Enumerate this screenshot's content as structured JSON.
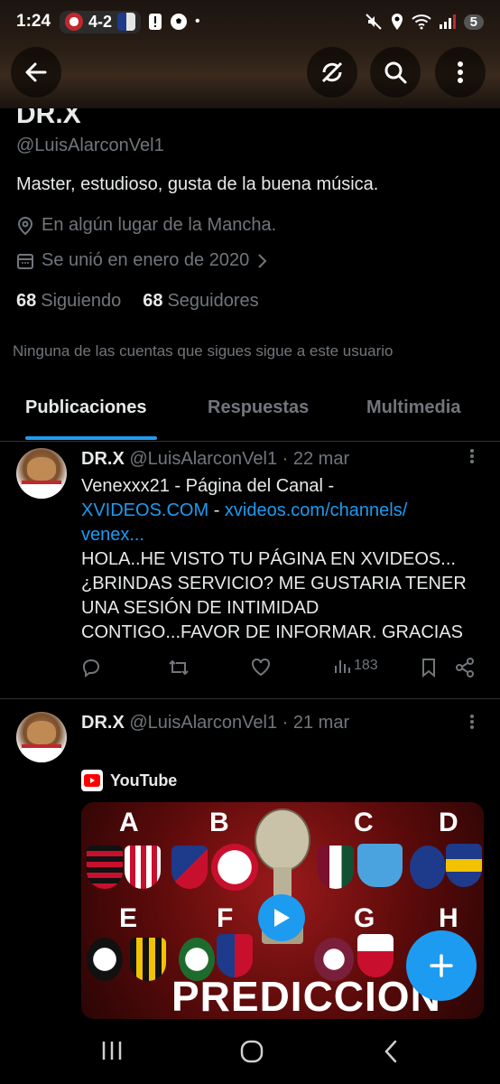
{
  "status_bar": {
    "time": "1:24",
    "score": "4-2",
    "battery": "5"
  },
  "profile": {
    "name": "DR.X",
    "handle": "@LuisAlarconVel1",
    "bio": "Master, estudioso, gusta de la buena música.",
    "location": "En algún lugar de la Mancha.",
    "joined": "Se unió en enero de 2020",
    "following_count": "68",
    "following_label": "Siguiendo",
    "followers_count": "68",
    "followers_label": "Seguidores",
    "mutual_notice": "Ninguna de las cuentas que sigues sigue a este usuario"
  },
  "tabs": [
    {
      "label": "Publicaciones",
      "active": true
    },
    {
      "label": "Respuestas",
      "active": false
    },
    {
      "label": "Multimedia",
      "active": false
    }
  ],
  "posts": [
    {
      "name": "DR.X",
      "handle": "@LuisAlarconVel1",
      "date": "· 22 mar",
      "line1": "Venexxx21 - Página del Canal -",
      "link1": "XVIDEOS.COM",
      "sep": " - ",
      "link2": "xvideos.com/channels/",
      "link2b": "venex...",
      "line3": "HOLA..HE VISTO TU PÁGINA EN XVIDEOS...",
      "line4": "¿BRINDAS SERVICIO? ME GUSTARIA TENER",
      "line5": "UNA SESIÓN DE INTIMIDAD",
      "line6": "CONTIGO...FAVOR DE INFORMAR. GRACIAS",
      "views": "183"
    },
    {
      "name": "DR.X",
      "handle": "@LuisAlarconVel1",
      "date": "· 21 mar",
      "card_source": "YouTube",
      "thumb_groups": [
        "A",
        "B",
        "C",
        "D",
        "E",
        "F",
        "G",
        "H"
      ],
      "thumb_title": "PREDICCION"
    }
  ],
  "colors": {
    "accent": "#1d9bf0",
    "background": "#000000",
    "muted_text": "#71767b",
    "primary_text": "#e7e9ea"
  },
  "icons": [
    "back-arrow-icon",
    "no-sync-icon",
    "search-icon",
    "more-vertical-icon",
    "location-pin-icon",
    "calendar-icon",
    "chevron-right-icon",
    "reply-icon",
    "repost-icon",
    "like-icon",
    "views-icon",
    "bookmark-icon",
    "share-icon",
    "youtube-icon",
    "play-icon",
    "plus-icon"
  ]
}
